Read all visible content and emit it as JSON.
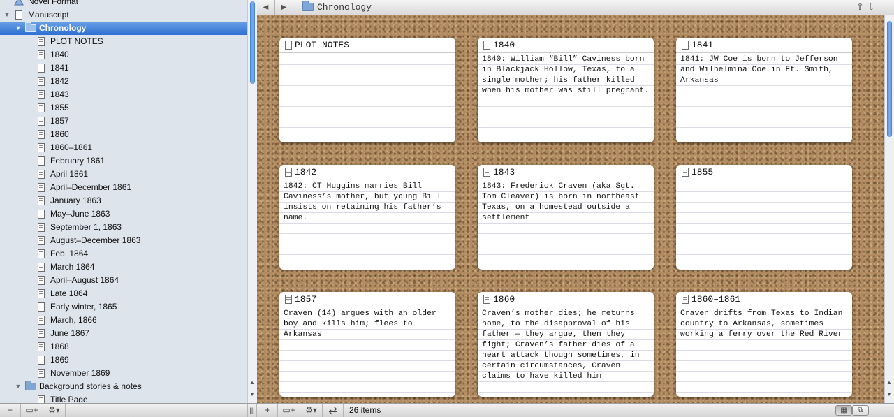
{
  "binder": {
    "rows": [
      {
        "label": "Novel Format",
        "type": "format",
        "indent": 1,
        "tri": ""
      },
      {
        "label": "Manuscript",
        "type": "doc",
        "indent": 1,
        "tri": "▼"
      },
      {
        "label": "Chronology",
        "type": "folder",
        "indent": 2,
        "tri": "▼",
        "selected": true
      },
      {
        "label": "PLOT NOTES",
        "type": "doc",
        "indent": 3,
        "tri": ""
      },
      {
        "label": "1840",
        "type": "doc",
        "indent": 3,
        "tri": ""
      },
      {
        "label": "1841",
        "type": "doc",
        "indent": 3,
        "tri": ""
      },
      {
        "label": "1842",
        "type": "doc",
        "indent": 3,
        "tri": ""
      },
      {
        "label": "1843",
        "type": "doc",
        "indent": 3,
        "tri": ""
      },
      {
        "label": "1855",
        "type": "doc",
        "indent": 3,
        "tri": ""
      },
      {
        "label": "1857",
        "type": "doc",
        "indent": 3,
        "tri": ""
      },
      {
        "label": "1860",
        "type": "doc",
        "indent": 3,
        "tri": ""
      },
      {
        "label": "1860–1861",
        "type": "doc",
        "indent": 3,
        "tri": ""
      },
      {
        "label": "February 1861",
        "type": "doc",
        "indent": 3,
        "tri": ""
      },
      {
        "label": "April 1861",
        "type": "doc",
        "indent": 3,
        "tri": ""
      },
      {
        "label": "April–December 1861",
        "type": "doc",
        "indent": 3,
        "tri": ""
      },
      {
        "label": "January 1863",
        "type": "doc",
        "indent": 3,
        "tri": ""
      },
      {
        "label": "May–June 1863",
        "type": "doc",
        "indent": 3,
        "tri": ""
      },
      {
        "label": "September 1, 1863",
        "type": "doc",
        "indent": 3,
        "tri": ""
      },
      {
        "label": "August–December 1863",
        "type": "doc",
        "indent": 3,
        "tri": ""
      },
      {
        "label": "Feb. 1864",
        "type": "doc",
        "indent": 3,
        "tri": ""
      },
      {
        "label": "March 1864",
        "type": "doc",
        "indent": 3,
        "tri": ""
      },
      {
        "label": "April–August 1864",
        "type": "doc",
        "indent": 3,
        "tri": ""
      },
      {
        "label": "Late 1864",
        "type": "doc",
        "indent": 3,
        "tri": ""
      },
      {
        "label": "Early winter, 1865",
        "type": "doc",
        "indent": 3,
        "tri": ""
      },
      {
        "label": "March, 1866",
        "type": "doc",
        "indent": 3,
        "tri": ""
      },
      {
        "label": "June 1867",
        "type": "doc",
        "indent": 3,
        "tri": ""
      },
      {
        "label": "1868",
        "type": "doc",
        "indent": 3,
        "tri": ""
      },
      {
        "label": "1869",
        "type": "doc",
        "indent": 3,
        "tri": ""
      },
      {
        "label": "November 1869",
        "type": "doc",
        "indent": 3,
        "tri": ""
      },
      {
        "label": "Background stories & notes",
        "type": "folder",
        "indent": 2,
        "tri": "▼"
      },
      {
        "label": "Title Page",
        "type": "doc",
        "indent": 3,
        "tri": ""
      }
    ]
  },
  "header": {
    "back": "◀",
    "forward": "▶",
    "title": "Chronology",
    "up": "⇧",
    "down": "⇩"
  },
  "cards": [
    {
      "title": "PLOT NOTES",
      "body": ""
    },
    {
      "title": "1840",
      "body": "1840: William “Bill” Caviness born in Blackjack Hollow, Texas, to a single mother; his father killed when his mother was still pregnant."
    },
    {
      "title": "1841",
      "body": "1841: JW Coe is born to Jefferson and Wilhelmina Coe in Ft. Smith, Arkansas"
    },
    {
      "title": "1842",
      "body": "1842: CT Huggins marries Bill Caviness’s mother, but young Bill insists on retaining his father’s name."
    },
    {
      "title": "1843",
      "body": "1843: Frederick Craven (aka Sgt. Tom Cleaver) is born in northeast Texas, on a homestead outside a settlement"
    },
    {
      "title": "1855",
      "body": ""
    },
    {
      "title": "1857",
      "body": "Craven (14) argues with an older boy and kills him; flees to Arkansas"
    },
    {
      "title": "1860",
      "body": "Craven’s mother dies; he returns home, to the disapproval of his father — they argue, then they fight; Craven’s father dies of a heart attack though sometimes, in certain circumstances, Craven claims to have killed him"
    },
    {
      "title": "1860–1861",
      "body": "Craven drifts from Texas to Indian country to Arkansas, sometimes working a ferry over the Red River"
    }
  ],
  "footer": {
    "add": "+",
    "add_folder": "▭+",
    "gear": "⚙▾",
    "split": "|||",
    "main_add": "+",
    "main_add_folder": "▭+",
    "main_gear": "⚙▾",
    "swap": "⇄",
    "item_count": "26 items",
    "view_cork": "▦",
    "view_outline": "⧉"
  },
  "colors": {
    "selection": "#2d6ed2",
    "binder_bg": "#dee4ec",
    "cork": "#b08a60"
  }
}
